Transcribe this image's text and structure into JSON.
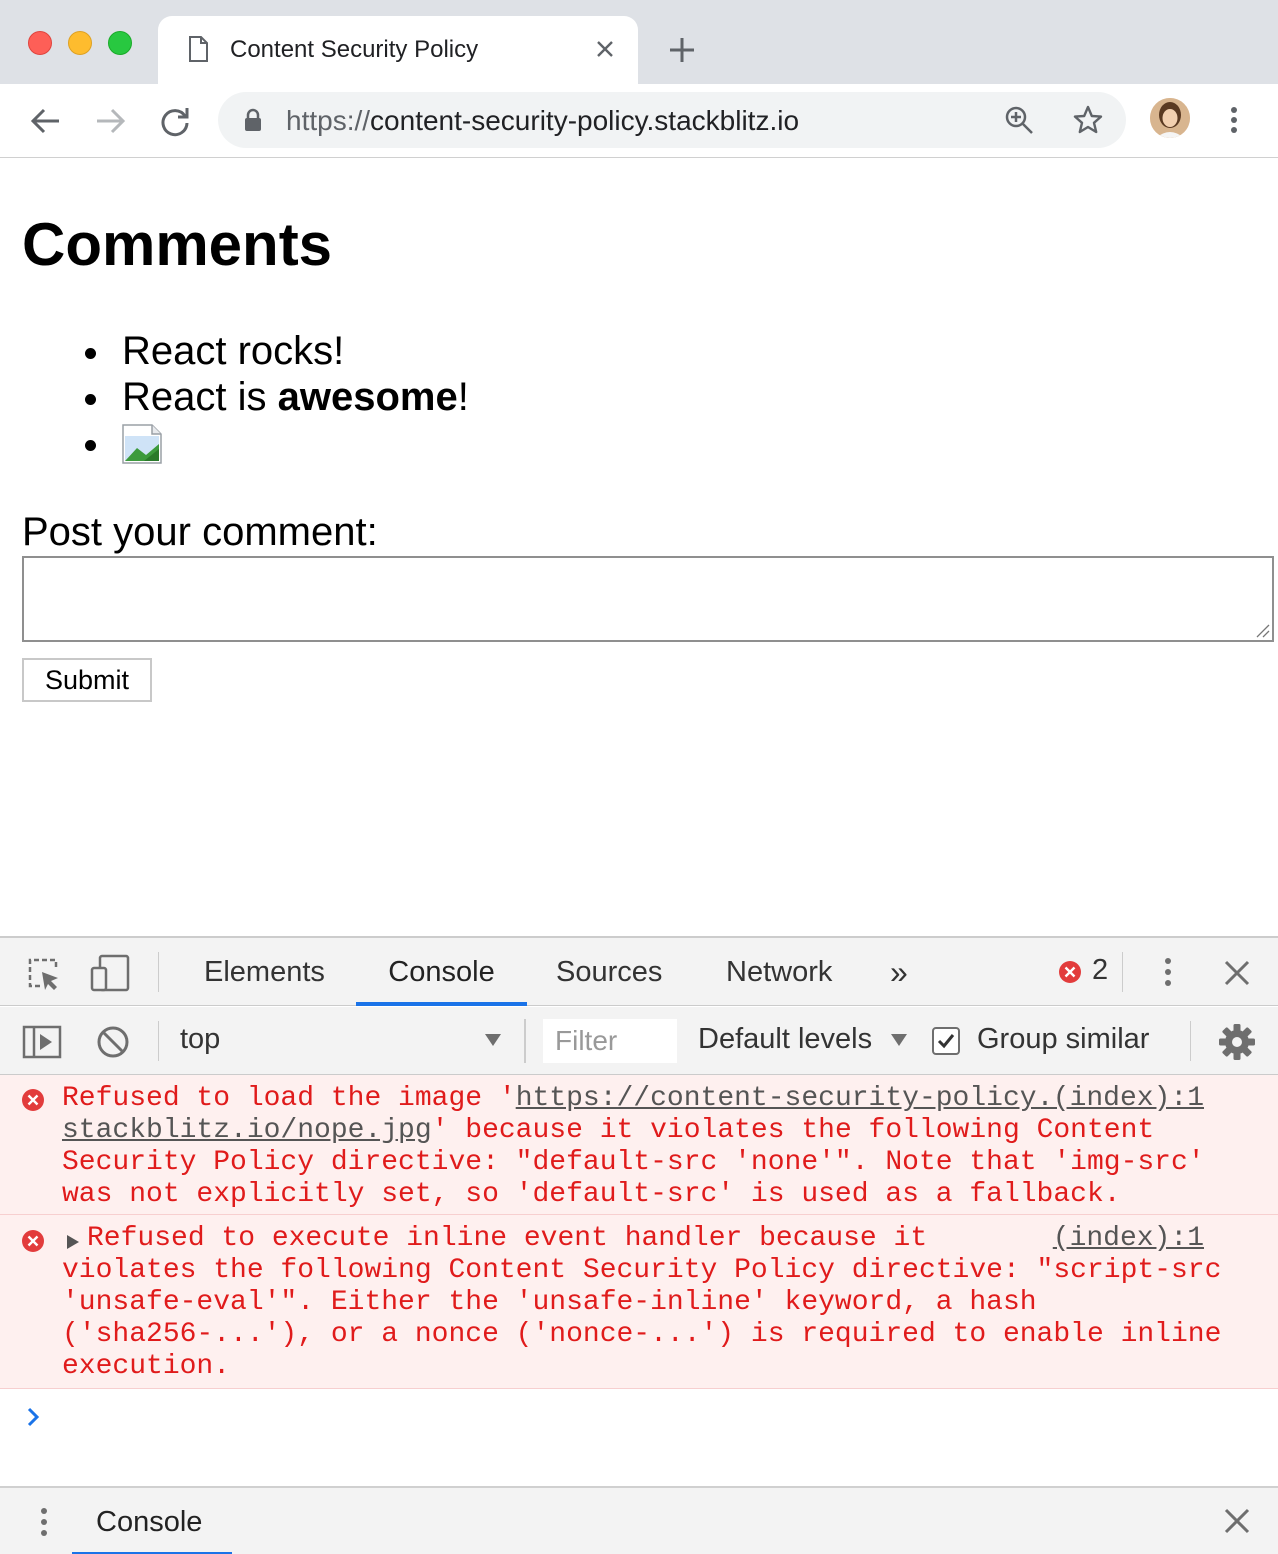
{
  "browser": {
    "tab_title": "Content Security Policy",
    "url_scheme": "https://",
    "url_host": "content-security-policy.stackblitz.io",
    "icons": [
      "page-icon",
      "close-icon",
      "plus-icon",
      "back-arrow-icon",
      "forward-arrow-icon",
      "reload-icon",
      "lock-icon",
      "zoom-icon",
      "star-icon",
      "avatar",
      "more-vert-icon"
    ]
  },
  "page": {
    "title": "Comments",
    "comments": {
      "c1": "React rocks!",
      "c2_prefix": "React is ",
      "c2_bold": "awesome",
      "c2_suffix": "!"
    },
    "post_label": "Post your comment:",
    "submit_label": "Submit"
  },
  "devtools": {
    "tabs": {
      "elements": "Elements",
      "console": "Console",
      "sources": "Sources",
      "network": "Network",
      "more": "»"
    },
    "error_count": "2",
    "context": "top",
    "filter_placeholder": "Filter",
    "levels": "Default levels",
    "group_similar": "Group similar",
    "drawer_tab": "Console",
    "accent_color": "#1a73e8",
    "error_color": "#e01b1b"
  },
  "console": {
    "messages": [
      {
        "line1_a": "Refused to load the image '",
        "line1_link": "https://content-security-policy.",
        "line2_link": "stackblitz.io/nope.jpg",
        "line2_b": "' because it violates the following Content",
        "line3": "Security Policy directive: \"default-src 'none'\". Note that 'img-src'",
        "line4": "was not explicitly set, so 'default-src' is used as a fallback.",
        "source": "(index):1"
      },
      {
        "line1": "Refused to execute inline event handler because it",
        "line2": "violates the following Content Security Policy directive: \"script-src",
        "line3": "'unsafe-eval'\". Either the 'unsafe-inline' keyword, a hash",
        "line4": "('sha256-...'), or a nonce ('nonce-...') is required to enable inline",
        "line5": "execution.",
        "source": "(index):1"
      }
    ]
  }
}
